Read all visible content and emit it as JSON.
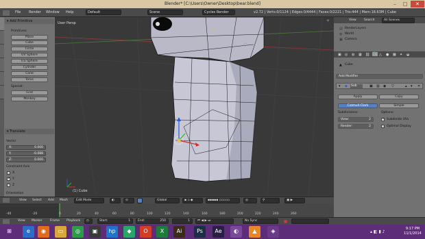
{
  "window": {
    "title": "Blender* [C:\\Users\\Owner\\Desktop\\bear.blend]"
  },
  "info_header": {
    "menus": [
      "File",
      "Render",
      "Window",
      "Help"
    ],
    "layout": "Default",
    "scene": "Scene",
    "engine": "Cycles Render",
    "stats": "v2.72 | Verts:0/1124 | Edges:0/4444 | Faces:0/2221 | Tris:444 | Mem:18.63M | Cube"
  },
  "toolshelf": {
    "add_primitive_title": "Add Primitive",
    "primitives_label": "Primitives:",
    "primitives": [
      "Plane",
      "Cube",
      "Circle",
      "UV Sphere",
      "Ico Sphere",
      "Cylinder",
      "Cone",
      "Torus"
    ],
    "special_label": "Special:",
    "special": [
      "Grid",
      "Monkey"
    ],
    "translate_title": "Translate",
    "vector_label": "Vector",
    "vector": [
      {
        "axis": "X:",
        "value": "0.000"
      },
      {
        "axis": "Y:",
        "value": "-0.088"
      },
      {
        "axis": "Z:",
        "value": "0.000"
      }
    ],
    "constraint_label": "Constraint Axis",
    "constraints": [
      "X",
      "Y",
      "Z"
    ],
    "orientation_label": "Orientation"
  },
  "viewport": {
    "view_label": "User Persp",
    "object_label": "(1) Cube"
  },
  "outliner": {
    "menus": [
      "View",
      "Search"
    ],
    "scene_select": "All Scenes",
    "items": [
      "RenderLayers",
      "World",
      "Camera"
    ]
  },
  "properties": {
    "object_name": "Cube",
    "add_modifier": "Add Modifier",
    "modifier_name": "Sub",
    "apply": "Apply",
    "copy": "Copy",
    "catmull": "Catmull-Clark",
    "simple": "Simple",
    "subdivisions_label": "Subdivisions:",
    "view_label": "View:",
    "view_value": "2",
    "render_label": "Render:",
    "render_value": "2",
    "options_label": "Options:",
    "subdivide_uvs": "Subdivide UVs",
    "optimal_display": "Optimal Display"
  },
  "view3d_header": {
    "menus": [
      "View",
      "Select",
      "Add",
      "Mesh"
    ],
    "mode": "Edit Mode",
    "orientation": "Global"
  },
  "timeline": {
    "ticks": [
      "-40",
      "-20",
      "0",
      "20",
      "40",
      "60",
      "80",
      "100",
      "120",
      "140",
      "160",
      "180",
      "200",
      "220",
      "240",
      "260"
    ]
  },
  "timeline_header": {
    "menus": [
      "View",
      "Marker",
      "Frame",
      "Playback"
    ],
    "start": "Start:",
    "start_value": "1",
    "end": "End:",
    "end_value": "250",
    "current": "1",
    "sync": "No Sync"
  },
  "taskbar": {
    "time": "9:17 PM",
    "date": "11/1/2014",
    "apps": [
      {
        "name": "start-icon",
        "color": "#5e2d7a",
        "glyph": "⊞"
      },
      {
        "name": "ie-icon",
        "color": "#2a6ec8",
        "glyph": "e"
      },
      {
        "name": "firefox-icon",
        "color": "#e06b1a",
        "glyph": "◉"
      },
      {
        "name": "explorer-icon",
        "color": "#d8a93a",
        "glyph": "▭"
      },
      {
        "name": "chrome-icon",
        "color": "#2c9c47",
        "glyph": "◎"
      },
      {
        "name": "media-icon",
        "color": "#3a3a3a",
        "glyph": "▣"
      },
      {
        "name": "hp-icon",
        "color": "#1f73c8",
        "glyph": "hp"
      },
      {
        "name": "store-icon",
        "color": "#2aa56a",
        "glyph": "◆"
      },
      {
        "name": "office-icon",
        "color": "#d43c26",
        "glyph": "O"
      },
      {
        "name": "excel-icon",
        "color": "#1f7a3c",
        "glyph": "X"
      },
      {
        "name": "illustrator-icon",
        "color": "#3c2a1a",
        "glyph": "Ai"
      },
      {
        "name": "photoshop-icon",
        "color": "#1a2e44",
        "glyph": "Ps"
      },
      {
        "name": "aftereffects-icon",
        "color": "#2a1e44",
        "glyph": "Ae"
      },
      {
        "name": "blender-icon",
        "color": "#e9862a",
        "glyph": "◐"
      },
      {
        "name": "vlc-icon",
        "color": "#e9862a",
        "glyph": "▲"
      },
      {
        "name": "app-icon",
        "color": "#6a3a8a",
        "glyph": "◈"
      }
    ]
  }
}
